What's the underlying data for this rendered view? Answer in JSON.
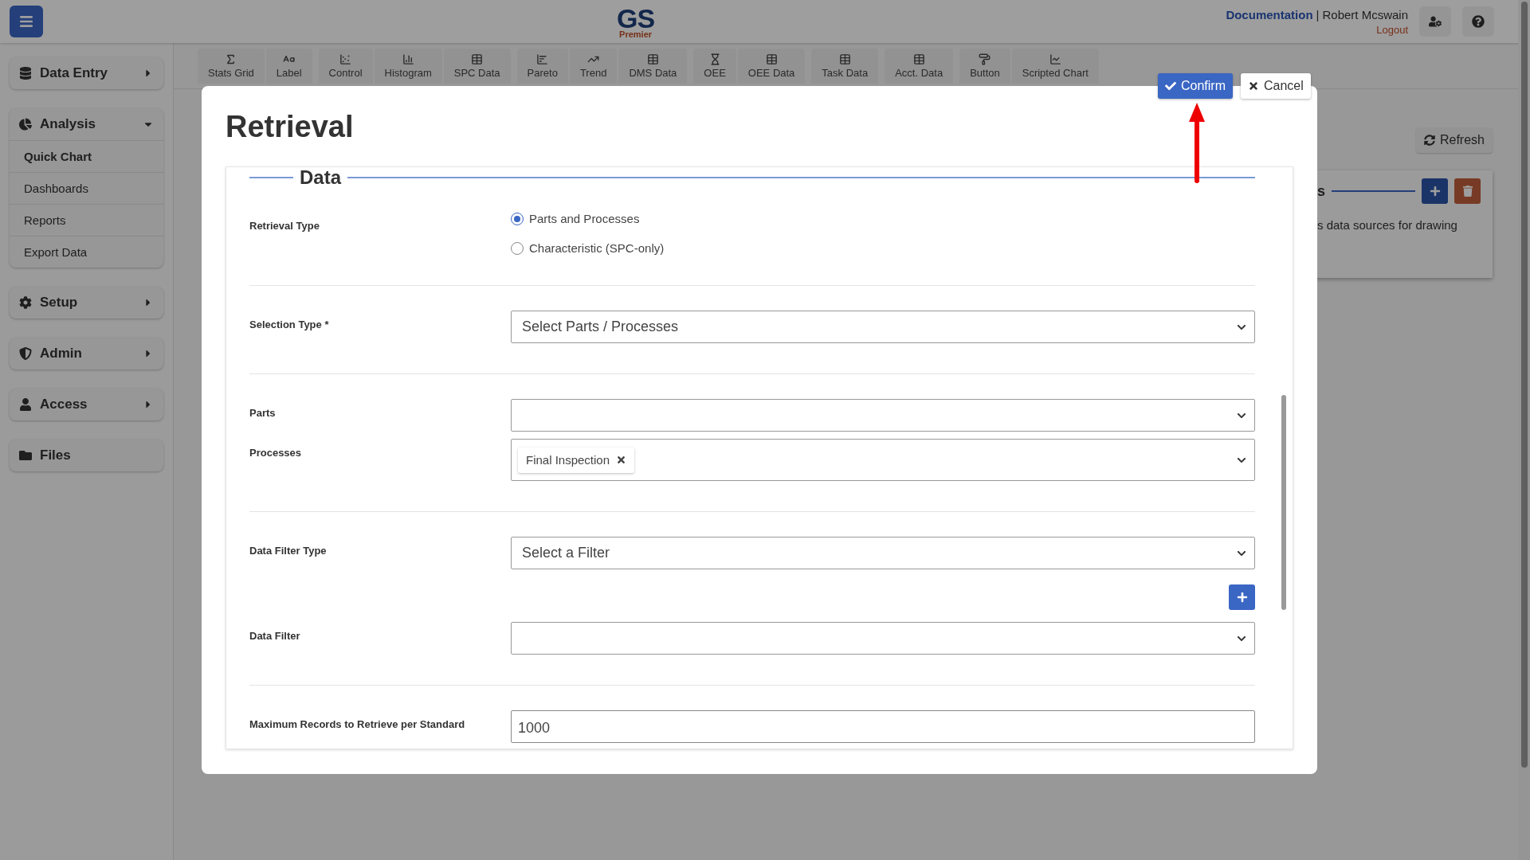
{
  "topbar": {
    "logo_main": "GS",
    "logo_sub": "Premier",
    "doc_link": "Documentation",
    "separator": "|",
    "user_name": "Robert Mcswain",
    "logout": "Logout"
  },
  "sidebar": {
    "sections": [
      {
        "label": "Data Entry",
        "expanded": false
      },
      {
        "label": "Analysis",
        "expanded": true,
        "children": [
          {
            "label": "Quick Chart",
            "selected": true
          },
          {
            "label": "Dashboards",
            "selected": false
          },
          {
            "label": "Reports",
            "selected": false
          },
          {
            "label": "Export Data",
            "selected": false
          }
        ]
      },
      {
        "label": "Setup",
        "expanded": false
      },
      {
        "label": "Admin",
        "expanded": false
      },
      {
        "label": "Access",
        "expanded": false
      },
      {
        "label": "Files"
      }
    ]
  },
  "toolbar": {
    "groups": [
      [
        "Stats Grid",
        "Label"
      ],
      [
        "Control",
        "Histogram",
        "SPC Data"
      ],
      [
        "Pareto",
        "Trend",
        "DMS Data"
      ],
      [
        "OEE",
        "OEE Data"
      ],
      [
        "Task Data"
      ],
      [
        "Acct. Data"
      ],
      [
        "Button",
        "Scripted Chart"
      ]
    ]
  },
  "background": {
    "refresh_button": "Refresh",
    "card_heading": "s",
    "card_text": "s data sources for drawing"
  },
  "modal": {
    "title": "Retrieval",
    "confirm": "Confirm",
    "cancel": "Cancel",
    "section_title": "Data",
    "groups": [
      [
        {
          "kind": "radio",
          "label": "Retrieval Type",
          "options": [
            {
              "label": "Parts and Processes",
              "selected": true
            },
            {
              "label": "Characteristic (SPC-only)",
              "selected": false
            }
          ]
        }
      ],
      [
        {
          "kind": "select",
          "label": "Selection Type *",
          "value": "Select Parts / Processes"
        }
      ],
      [
        {
          "kind": "multiselect",
          "label": "Parts"
        },
        {
          "kind": "multiselect",
          "label": "Processes",
          "tags": [
            "Final Inspection"
          ]
        }
      ],
      [
        {
          "kind": "select",
          "label": "Data Filter Type",
          "value": "Select a Filter",
          "add_button": true
        },
        {
          "kind": "multiselect",
          "label": "Data Filter"
        }
      ],
      [
        {
          "kind": "text",
          "label": "Maximum Records to Retrieve per Standard",
          "value": "1000"
        }
      ]
    ]
  }
}
